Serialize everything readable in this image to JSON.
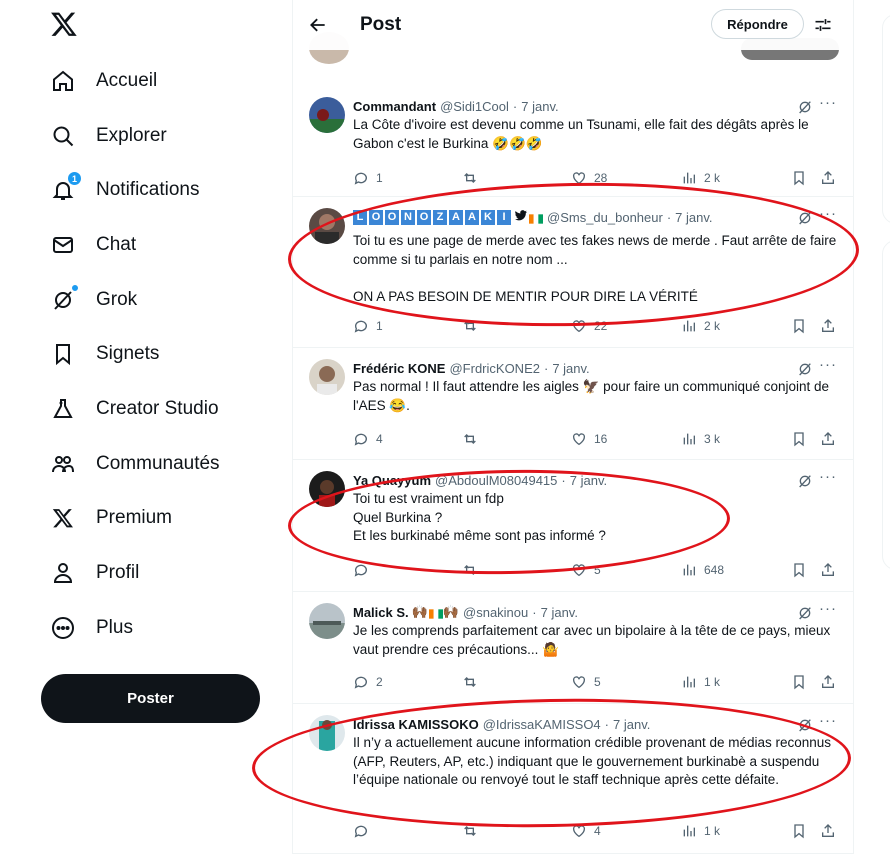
{
  "nav": {
    "items": [
      {
        "label": "Accueil",
        "icon": "home-icon"
      },
      {
        "label": "Explorer",
        "icon": "search-icon"
      },
      {
        "label": "Notifications",
        "icon": "bell-icon",
        "badge": "1"
      },
      {
        "label": "Chat",
        "icon": "mail-icon"
      },
      {
        "label": "Grok",
        "icon": "grok-icon"
      },
      {
        "label": "Signets",
        "icon": "bookmark-icon"
      },
      {
        "label": "Creator Studio",
        "icon": "flask-icon"
      },
      {
        "label": "Communautés",
        "icon": "people-icon"
      },
      {
        "label": "Premium",
        "icon": "x-logo-icon"
      },
      {
        "label": "Profil",
        "icon": "person-icon"
      },
      {
        "label": "Plus",
        "icon": "more-circle-icon"
      }
    ],
    "post_button": "Poster"
  },
  "header": {
    "title": "Post",
    "reply_button": "Répondre"
  },
  "tweets": [
    {
      "name": "Commandant",
      "handle": "@Sidi1Cool",
      "date": "7 janv.",
      "text": "La Côte d'ivoire est devenu comme un Tsunami, elle fait des dégâts après le Gabon c'est le Burkina 🤣🤣🤣",
      "replies": "1",
      "reposts": "",
      "likes": "28",
      "views": "2 k"
    },
    {
      "name": "LOONOZAAKI",
      "handle": "@Sms_du_bonheur",
      "date": "7 janv.",
      "text": "Toi tu es une page de merde avec tes fakes news de merde . Faut arrête de faire comme si tu parlais en notre nom ...\n\nON A PAS BESOIN DE MENTIR POUR DIRE LA VÉRITÉ",
      "replies": "1",
      "reposts": "",
      "likes": "22",
      "views": "2 k"
    },
    {
      "name": "Frédéric KONE",
      "handle": "@FrdricKONE2",
      "date": "7 janv.",
      "text": "Pas normal ! Il faut attendre les aigles 🦅 pour faire un communiqué conjoint de l'AES 😂.",
      "replies": "4",
      "reposts": "",
      "likes": "16",
      "views": "3 k"
    },
    {
      "name": "Ya Quayyum",
      "handle": "@AbdoulM08049415",
      "date": "7 janv.",
      "text": "Toi tu est vraiment un fdp\nQuel Burkina ?\nEt les burkinabé même sont pas informé ?",
      "replies": "",
      "reposts": "",
      "likes": "5",
      "views": "648"
    },
    {
      "name": "Malick S.",
      "handle": "@snakinou",
      "date": "7 janv.",
      "text": "Je les comprends parfaitement car avec un bipolaire à la tête de ce pays, mieux vaut prendre ces précautions... 🤷",
      "replies": "2",
      "reposts": "",
      "likes": "5",
      "views": "1 k"
    },
    {
      "name": "Idrissa KAMISSOKO",
      "handle": "@IdrissaKAMISSO4",
      "date": "7 janv.",
      "text": "Il n’y a actuellement aucune information crédible provenant de médias reconnus (AFP, Reuters, AP, etc.) indiquant que le gouvernement burkinabè a suspendu l’équipe nationale ou renvoyé tout le staff technique après cette défaite.",
      "replies": "",
      "reposts": "",
      "likes": "4",
      "views": "1 k"
    }
  ],
  "colors": {
    "accent": "#1d9bf0",
    "annotation": "#e0141b",
    "text": "#0f1419",
    "muted": "#536471"
  }
}
